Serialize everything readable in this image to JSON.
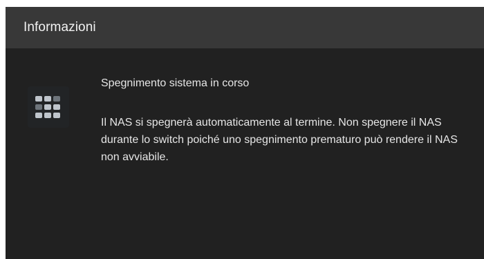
{
  "dialog": {
    "title": "Informazioni",
    "icon": "app-grid-icon",
    "heading": "Spegnimento sistema in corso",
    "body": " Il NAS si spegnerà automaticamente al termine. Non spegnere il NAS durante lo switch poiché uno spegnimento prematuro può rendere il NAS non avviabile."
  },
  "colors": {
    "titlebar_bg": "#383838",
    "dialog_bg": "#212121",
    "icon_light": "#bfc5cc",
    "icon_dark": "#6d747b"
  }
}
